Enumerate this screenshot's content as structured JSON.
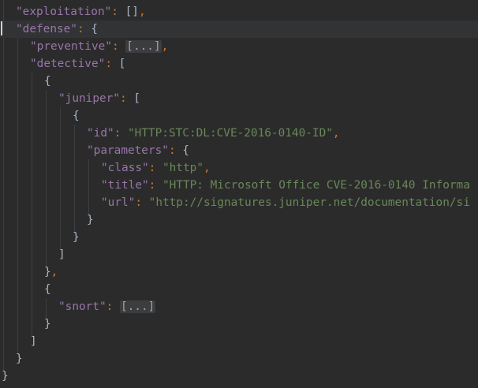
{
  "editor": {
    "lines": [
      {
        "key": "\"exploitation\"",
        "colon": ": ",
        "value": "[]",
        "comma": ","
      },
      {
        "key": "\"defense\"",
        "colon": ": ",
        "open": "{"
      },
      {
        "key": "\"preventive\"",
        "colon": ": ",
        "folded": "[...]",
        "comma": ","
      },
      {
        "key": "\"detective\"",
        "colon": ": ",
        "open": "["
      },
      {
        "open": "{"
      },
      {
        "key": "\"juniper\"",
        "colon": ": ",
        "open": "["
      },
      {
        "open": "{"
      },
      {
        "key": "\"id\"",
        "colon": ": ",
        "string": "\"HTTP:STC:DL:CVE-2016-0140-ID\"",
        "comma": ","
      },
      {
        "key": "\"parameters\"",
        "colon": ": ",
        "open": "{"
      },
      {
        "key": "\"class\"",
        "colon": ": ",
        "string": "\"http\"",
        "comma": ","
      },
      {
        "key": "\"title\"",
        "colon": ": ",
        "string": "\"HTTP: Microsoft Office CVE-2016-0140 Informa"
      },
      {
        "key": "\"url\"",
        "colon": ": ",
        "string": "\"http://signatures.juniper.net/documentation/si"
      },
      {
        "close": "}"
      },
      {
        "close": "}"
      },
      {
        "close": "]"
      },
      {
        "close": "}",
        "comma": ","
      },
      {
        "open": "{"
      },
      {
        "key": "\"snort\"",
        "colon": ": ",
        "folded": "[...]"
      },
      {
        "close": "}"
      },
      {
        "close": "]"
      },
      {
        "close": "}"
      },
      {
        "close": "}"
      }
    ]
  }
}
